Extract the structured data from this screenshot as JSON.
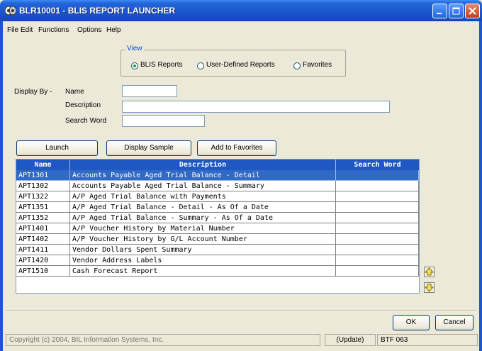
{
  "window": {
    "title": "BLR10001 - BLIS REPORT LAUNCHER"
  },
  "menu": {
    "items": [
      "File",
      "Edit",
      "Functions",
      "Options",
      "Help"
    ]
  },
  "view": {
    "legend": "View",
    "options": [
      "BLIS Reports",
      "User-Defined Reports",
      "Favorites"
    ],
    "selected": "BLIS Reports"
  },
  "display_by": {
    "label": "Display By -",
    "name_label": "Name",
    "name_value": "",
    "description_label": "Description",
    "description_value": "",
    "search_word_label": "Search Word",
    "search_word_value": ""
  },
  "actions": {
    "launch": "Launch",
    "display_sample": "Display Sample",
    "add_to_favorites": "Add to Favorites"
  },
  "grid": {
    "columns": [
      "Name",
      "Description",
      "Search Word"
    ],
    "rows": [
      {
        "name": "APT1301",
        "description": "Accounts Payable Aged Trial Balance - Detail",
        "search_word": ""
      },
      {
        "name": "APT1302",
        "description": "Accounts Payable Aged Trial Balance - Summary",
        "search_word": ""
      },
      {
        "name": "APT1322",
        "description": "A/P Aged Trial Balance with Payments",
        "search_word": ""
      },
      {
        "name": "APT1351",
        "description": "A/P Aged Trial Balance - Detail - As Of a Date",
        "search_word": ""
      },
      {
        "name": "APT1352",
        "description": "A/P Aged Trial Balance - Summary - As Of a Date",
        "search_word": ""
      },
      {
        "name": "APT1401",
        "description": "A/P Voucher History by Material Number",
        "search_word": ""
      },
      {
        "name": "APT1402",
        "description": "A/P Voucher History by G/L Account Number",
        "search_word": ""
      },
      {
        "name": "APT1411",
        "description": "Vendor Dollars Spent Summary",
        "search_word": ""
      },
      {
        "name": "APT1420",
        "description": "Vendor Address Labels",
        "search_word": ""
      },
      {
        "name": "APT1510",
        "description": "Cash Forecast Report",
        "search_word": ""
      }
    ],
    "selected_index": 0
  },
  "footer": {
    "ok": "OK",
    "cancel": "Cancel"
  },
  "status": {
    "copyright": "Copyright (c) 2004, BIL Information Systems, Inc.",
    "mode": "(Update)",
    "code": "BTF 063"
  },
  "colors": {
    "title_bar": "#1b56cc",
    "grid_header": "#1f57c3",
    "selection": "#316ac5",
    "view_legend": "#0046d5"
  },
  "icons": [
    "app-icon",
    "minimize-icon",
    "maximize-icon",
    "close-icon",
    "arrow-up-icon",
    "arrow-down-icon"
  ]
}
